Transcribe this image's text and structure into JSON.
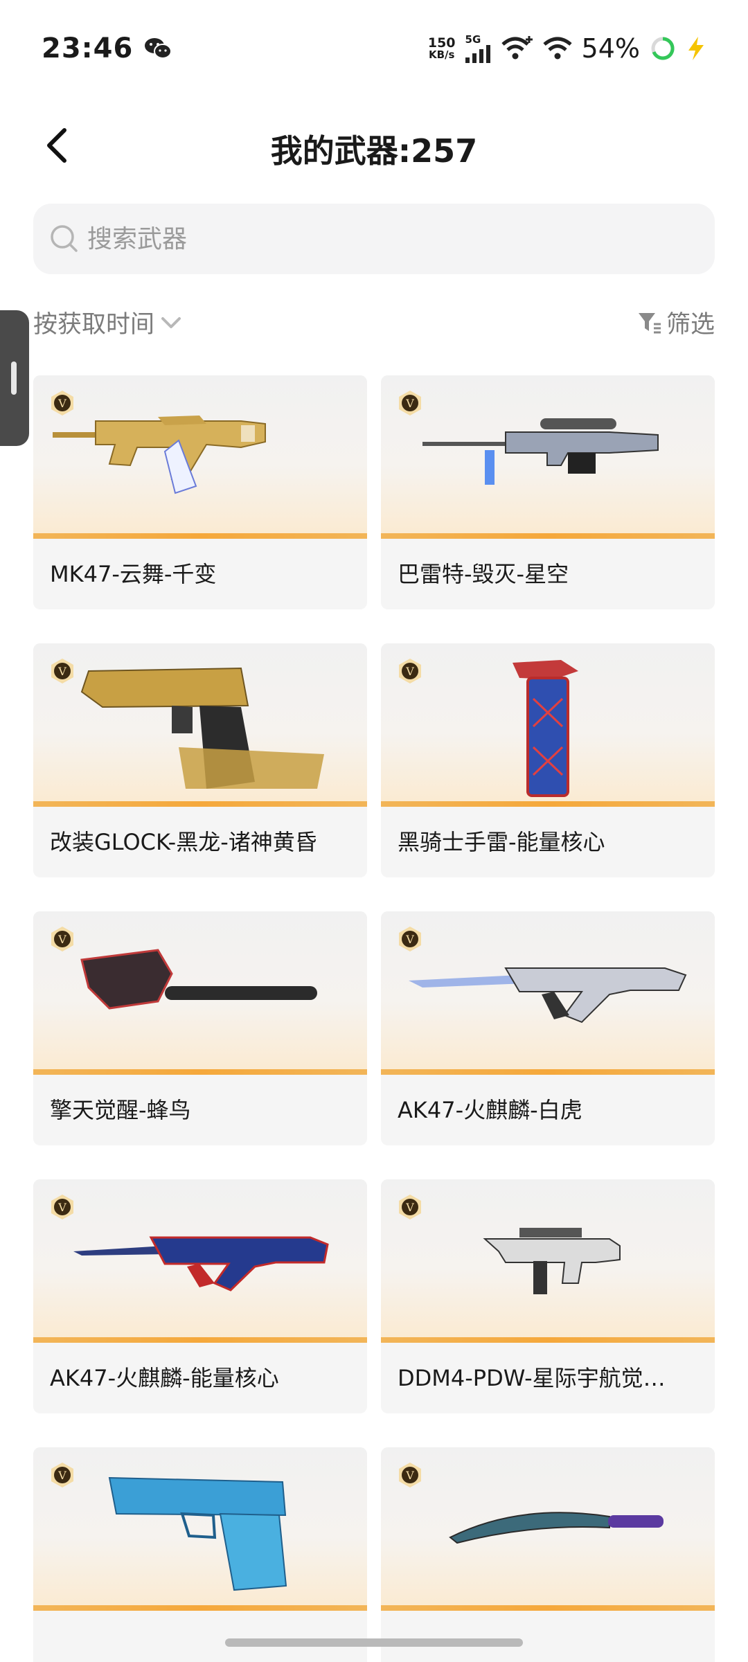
{
  "status_bar": {
    "time": "23:46",
    "net_speed_value": "150",
    "net_speed_unit": "KB/s",
    "network_type": "5G",
    "battery": "54%",
    "icons": [
      "wechat-icon",
      "signal-bars-icon",
      "wifi-plus-icon",
      "wifi-icon",
      "battery-ring-icon",
      "bolt-icon"
    ]
  },
  "header": {
    "title": "我的武器:257",
    "back_icon": "chevron-left-icon"
  },
  "search": {
    "placeholder": "搜索武器",
    "value": ""
  },
  "sort": {
    "label": "按获取时间",
    "filter_label": "筛选"
  },
  "weapons": [
    {
      "name": "MK47-云舞-千变",
      "badge": "V"
    },
    {
      "name": "巴雷特-毁灭-星空",
      "badge": "V"
    },
    {
      "name": "改装GLOCK-黑龙-诸神黄昏",
      "badge": "V"
    },
    {
      "name": "黑骑士手雷-能量核心",
      "badge": "V"
    },
    {
      "name": "擎天觉醒-蜂鸟",
      "badge": "V"
    },
    {
      "name": "AK47-火麒麟-白虎",
      "badge": "V"
    },
    {
      "name": "AK47-火麒麟-能量核心",
      "badge": "V"
    },
    {
      "name": "DDM4-PDW-星际宇航觉…",
      "badge": "V"
    },
    {
      "name": "",
      "badge": "V"
    },
    {
      "name": "",
      "badge": "V"
    }
  ],
  "colors": {
    "accent_stripe": "#f5a83b",
    "card_bg": "#f5f5f5",
    "search_bg": "#f4f4f5"
  }
}
